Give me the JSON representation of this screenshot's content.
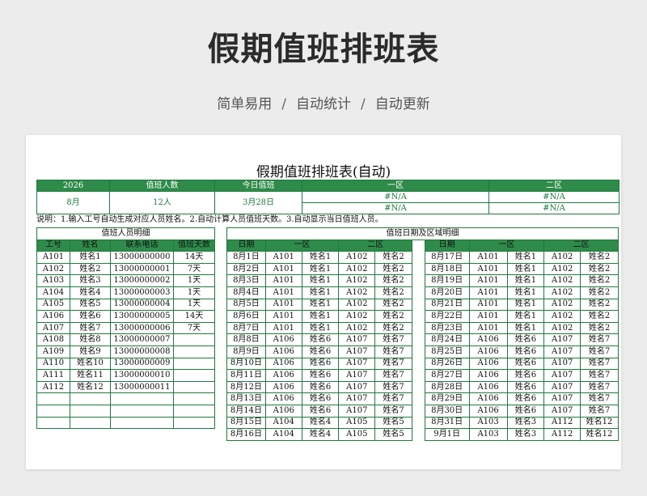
{
  "hero": {
    "title": "假期值班排班表",
    "features": [
      "简单易用",
      "自动统计",
      "自动更新"
    ],
    "separator": "/"
  },
  "sheet": {
    "title": "假期值班排班表(自动)",
    "info": {
      "year": "2026",
      "month": "8月",
      "staff_count_label": "值班人数",
      "staff_count": "12人",
      "today_label": "今日值班",
      "today": "3月28日",
      "zone1_label": "一区",
      "zone2_label": "二区",
      "na": "#N/A"
    },
    "note": "说明：1.输入工号自动生成对应人员姓名。2.自动计算人员值班天数。3.自动显示当日值班人员。",
    "staff": {
      "caption": "值班人员明细",
      "headers": [
        "工号",
        "姓名",
        "联系电话",
        "值班天数"
      ],
      "rows": [
        [
          "A101",
          "姓名1",
          "13000000000",
          "14天"
        ],
        [
          "A102",
          "姓名2",
          "13000000001",
          "7天"
        ],
        [
          "A103",
          "姓名3",
          "13000000002",
          "1天"
        ],
        [
          "A104",
          "姓名4",
          "13000000003",
          "1天"
        ],
        [
          "A105",
          "姓名5",
          "13000000004",
          "1天"
        ],
        [
          "A106",
          "姓名6",
          "13000000005",
          "14天"
        ],
        [
          "A107",
          "姓名7",
          "13000000006",
          "7天"
        ],
        [
          "A108",
          "姓名8",
          "13000000007",
          ""
        ],
        [
          "A109",
          "姓名9",
          "13000000008",
          ""
        ],
        [
          "A110",
          "姓名10",
          "13000000009",
          ""
        ],
        [
          "A111",
          "姓名11",
          "13000000010",
          ""
        ],
        [
          "A112",
          "姓名12",
          "13000000011",
          ""
        ],
        [
          "",
          "",
          "",
          ""
        ],
        [
          "",
          "",
          "",
          ""
        ],
        [
          "",
          "",
          "",
          ""
        ]
      ]
    },
    "duty": {
      "caption": "值班日期及区域明细",
      "headers": [
        "日期",
        "一区",
        "二区"
      ],
      "left": [
        [
          "8月1日",
          "A101",
          "姓名1",
          "A102",
          "姓名2"
        ],
        [
          "8月2日",
          "A101",
          "姓名1",
          "A102",
          "姓名2"
        ],
        [
          "8月3日",
          "A101",
          "姓名1",
          "A102",
          "姓名2"
        ],
        [
          "8月4日",
          "A101",
          "姓名1",
          "A102",
          "姓名2"
        ],
        [
          "8月5日",
          "A101",
          "姓名1",
          "A102",
          "姓名2"
        ],
        [
          "8月6日",
          "A101",
          "姓名1",
          "A102",
          "姓名2"
        ],
        [
          "8月7日",
          "A101",
          "姓名1",
          "A102",
          "姓名2"
        ],
        [
          "8月8日",
          "A106",
          "姓名6",
          "A107",
          "姓名7"
        ],
        [
          "8月9日",
          "A106",
          "姓名6",
          "A107",
          "姓名7"
        ],
        [
          "8月10日",
          "A106",
          "姓名6",
          "A107",
          "姓名7"
        ],
        [
          "8月11日",
          "A106",
          "姓名6",
          "A107",
          "姓名7"
        ],
        [
          "8月12日",
          "A106",
          "姓名6",
          "A107",
          "姓名7"
        ],
        [
          "8月13日",
          "A106",
          "姓名6",
          "A107",
          "姓名7"
        ],
        [
          "8月14日",
          "A106",
          "姓名6",
          "A107",
          "姓名7"
        ],
        [
          "8月15日",
          "A104",
          "姓名4",
          "A105",
          "姓名5"
        ],
        [
          "8月16日",
          "A104",
          "姓名4",
          "A105",
          "姓名5"
        ]
      ],
      "right": [
        [
          "8月17日",
          "A101",
          "姓名1",
          "A102",
          "姓名2"
        ],
        [
          "8月18日",
          "A101",
          "姓名1",
          "A102",
          "姓名2"
        ],
        [
          "8月19日",
          "A101",
          "姓名1",
          "A102",
          "姓名2"
        ],
        [
          "8月20日",
          "A101",
          "姓名1",
          "A102",
          "姓名2"
        ],
        [
          "8月21日",
          "A101",
          "姓名1",
          "A102",
          "姓名2"
        ],
        [
          "8月22日",
          "A101",
          "姓名1",
          "A102",
          "姓名2"
        ],
        [
          "8月23日",
          "A101",
          "姓名1",
          "A102",
          "姓名2"
        ],
        [
          "8月24日",
          "A106",
          "姓名6",
          "A107",
          "姓名7"
        ],
        [
          "8月25日",
          "A106",
          "姓名6",
          "A107",
          "姓名7"
        ],
        [
          "8月26日",
          "A106",
          "姓名6",
          "A107",
          "姓名7"
        ],
        [
          "8月27日",
          "A106",
          "姓名6",
          "A107",
          "姓名7"
        ],
        [
          "8月28日",
          "A106",
          "姓名6",
          "A107",
          "姓名7"
        ],
        [
          "8月29日",
          "A106",
          "姓名6",
          "A107",
          "姓名7"
        ],
        [
          "8月30日",
          "A106",
          "姓名6",
          "A107",
          "姓名7"
        ],
        [
          "8月31日",
          "A103",
          "姓名3",
          "A112",
          "姓名12"
        ],
        [
          "9月1日",
          "A103",
          "姓名3",
          "A112",
          "姓名12"
        ]
      ]
    },
    "colors": {
      "accent": "#2e8b4a",
      "border": "#1f7a3c"
    }
  }
}
